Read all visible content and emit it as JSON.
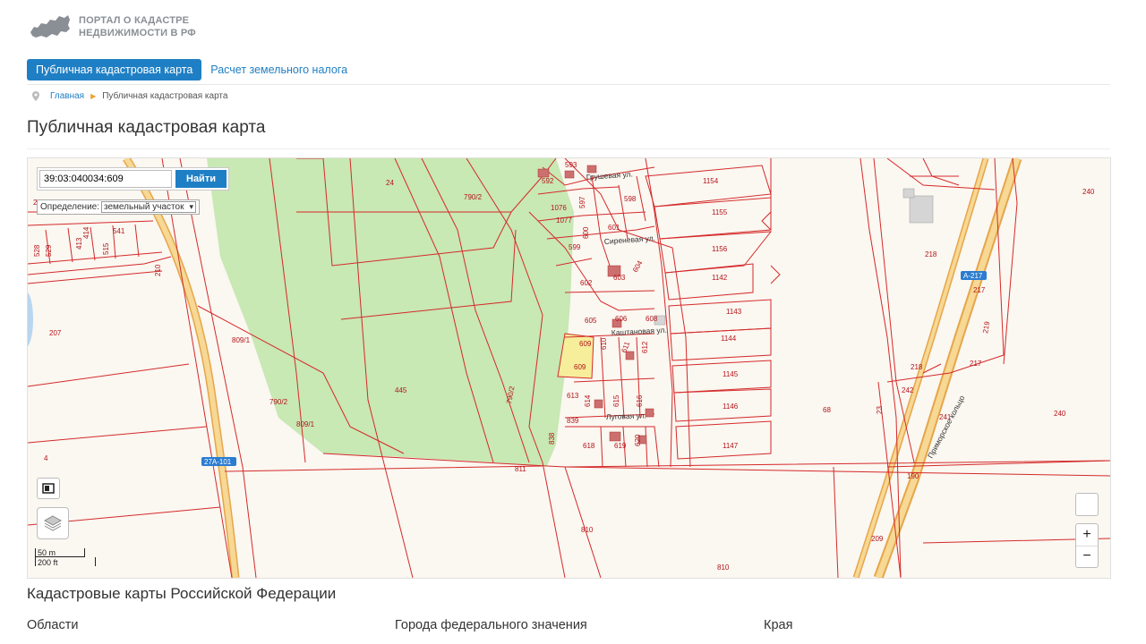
{
  "header": {
    "logo_line1": "ПОРТАЛ О КАДАСТРЕ",
    "logo_line2": "НЕДВИЖИМОСТИ В РФ"
  },
  "nav": {
    "active": "Публичная кадастровая карта",
    "link": "Расчет земельного налога"
  },
  "breadcrumb": {
    "home": "Главная",
    "current": "Публичная кадастровая карта"
  },
  "page_title": "Публичная кадастровая карта",
  "map": {
    "search_value": "39:03:040034:609",
    "search_button": "Найти",
    "definition_label": "Определение:",
    "definition_value": "земельный участок",
    "scale_m": "50 m",
    "scale_ft": "200 ft",
    "zoom_in": "+",
    "zoom_out": "−",
    "road_badges": [
      "27А-101",
      "А-217"
    ],
    "streets": [
      "Грушевая ул.",
      "Сиреневая ул.",
      "Каштановая ул.",
      "Луговая ул.",
      "Приморское кольцо"
    ],
    "parcels": [
      "24",
      "790/2",
      "790/2",
      "790/2",
      "445",
      "809/1",
      "809/1",
      "207",
      "4",
      "811",
      "810",
      "810",
      "1154",
      "1155",
      "1156",
      "1142",
      "1143",
      "1144",
      "1145",
      "1146",
      "1147",
      "592",
      "1076",
      "1077",
      "597",
      "598",
      "599",
      "600",
      "601",
      "602",
      "603",
      "604",
      "605",
      "606",
      "608",
      "609",
      "609",
      "610",
      "611",
      "612",
      "613",
      "614",
      "615",
      "616",
      "618",
      "619",
      "620",
      "838",
      "839",
      "240",
      "240",
      "218",
      "217",
      "219",
      "218",
      "217",
      "242",
      "241",
      "68",
      "23",
      "190",
      "209",
      "413",
      "414",
      "515",
      "541",
      "528",
      "529",
      "210",
      "217",
      "593"
    ],
    "colors": {
      "boundary": "#d42a2a",
      "forest": "#c8e8b4",
      "road": "#f3c36a",
      "selected": "#f6ee9a",
      "badge": "#2b7cd0"
    }
  },
  "section": {
    "title": "Кадастровые карты Российской Федерации",
    "columns": [
      "Области",
      "Города федерального значения",
      "Края"
    ]
  }
}
